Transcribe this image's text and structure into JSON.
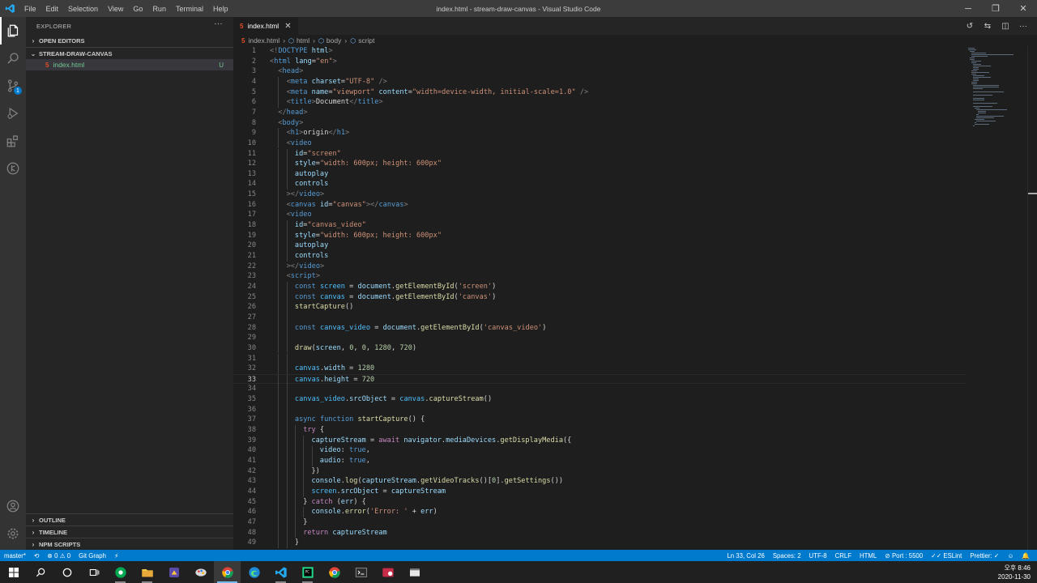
{
  "titlebar": {
    "title": "index.html - stream-draw-canvas - Visual Studio Code",
    "menu": [
      "File",
      "Edit",
      "Selection",
      "View",
      "Go",
      "Run",
      "Terminal",
      "Help"
    ],
    "controls": [
      "─",
      "❐",
      "✕"
    ]
  },
  "activitybar": {
    "items": [
      "explorer-icon",
      "search-icon",
      "source-control-icon",
      "run-debug-icon",
      "extensions-icon",
      "git-graph-icon"
    ],
    "scm_badge": "1",
    "bottom": [
      "account-icon",
      "settings-gear-icon"
    ]
  },
  "sidebar": {
    "title": "EXPLORER",
    "more": "···",
    "open_editors": "OPEN EDITORS",
    "folder": "STREAM-DRAW-CANVAS",
    "file": {
      "name": "index.html",
      "status": "U"
    },
    "outline": "OUTLINE",
    "timeline": "TIMELINE",
    "npm_scripts": "NPM SCRIPTS"
  },
  "tab": {
    "label": "index.html",
    "close": "✕"
  },
  "tab_actions": [
    "↺",
    "⇆",
    "◫",
    "···"
  ],
  "breadcrumb": [
    "index.html",
    "html",
    "body",
    "script"
  ],
  "code_lines": [
    {
      "n": "1",
      "indent": 0,
      "t": [
        [
          "br",
          "<!"
        ],
        [
          "tag",
          "DOCTYPE "
        ],
        [
          "attr",
          "html"
        ],
        [
          "br",
          ">"
        ]
      ]
    },
    {
      "n": "2",
      "indent": 0,
      "t": [
        [
          "br",
          "<"
        ],
        [
          "tag",
          "html "
        ],
        [
          "attr",
          "lang"
        ],
        [
          "txt",
          "="
        ],
        [
          "str",
          "\"en\""
        ],
        [
          "br",
          ">"
        ]
      ]
    },
    {
      "n": "3",
      "indent": 1,
      "t": [
        [
          "br",
          "<"
        ],
        [
          "tag",
          "head"
        ],
        [
          "br",
          ">"
        ]
      ]
    },
    {
      "n": "4",
      "indent": 2,
      "t": [
        [
          "br",
          "<"
        ],
        [
          "tag",
          "meta "
        ],
        [
          "attr",
          "charset"
        ],
        [
          "txt",
          "="
        ],
        [
          "str",
          "\"UTF-8\""
        ],
        [
          "br",
          " />"
        ]
      ]
    },
    {
      "n": "5",
      "indent": 2,
      "t": [
        [
          "br",
          "<"
        ],
        [
          "tag",
          "meta "
        ],
        [
          "attr",
          "name"
        ],
        [
          "txt",
          "="
        ],
        [
          "str",
          "\"viewport\" "
        ],
        [
          "attr",
          "content"
        ],
        [
          "txt",
          "="
        ],
        [
          "str",
          "\"width=device-width, initial-scale=1.0\""
        ],
        [
          "br",
          " />"
        ]
      ]
    },
    {
      "n": "6",
      "indent": 2,
      "t": [
        [
          "br",
          "<"
        ],
        [
          "tag",
          "title"
        ],
        [
          "br",
          ">"
        ],
        [
          "txt",
          "Document"
        ],
        [
          "br",
          "</"
        ],
        [
          "tag",
          "title"
        ],
        [
          "br",
          ">"
        ]
      ]
    },
    {
      "n": "7",
      "indent": 1,
      "t": [
        [
          "br",
          "</"
        ],
        [
          "tag",
          "head"
        ],
        [
          "br",
          ">"
        ]
      ]
    },
    {
      "n": "8",
      "indent": 1,
      "t": [
        [
          "br",
          "<"
        ],
        [
          "tag",
          "body"
        ],
        [
          "br",
          ">"
        ]
      ]
    },
    {
      "n": "9",
      "indent": 2,
      "t": [
        [
          "br",
          "<"
        ],
        [
          "tag",
          "h1"
        ],
        [
          "br",
          ">"
        ],
        [
          "txt",
          "origin"
        ],
        [
          "br",
          "</"
        ],
        [
          "tag",
          "h1"
        ],
        [
          "br",
          ">"
        ]
      ]
    },
    {
      "n": "10",
      "indent": 2,
      "t": [
        [
          "br",
          "<"
        ],
        [
          "tag",
          "video"
        ]
      ]
    },
    {
      "n": "11",
      "indent": 3,
      "t": [
        [
          "attr",
          "id"
        ],
        [
          "txt",
          "="
        ],
        [
          "str",
          "\"screen\""
        ]
      ]
    },
    {
      "n": "12",
      "indent": 3,
      "t": [
        [
          "attr",
          "style"
        ],
        [
          "txt",
          "="
        ],
        [
          "str",
          "\"width: 600px; height: 600px\""
        ]
      ]
    },
    {
      "n": "13",
      "indent": 3,
      "t": [
        [
          "attr",
          "autoplay"
        ]
      ]
    },
    {
      "n": "14",
      "indent": 3,
      "t": [
        [
          "attr",
          "controls"
        ]
      ]
    },
    {
      "n": "15",
      "indent": 2,
      "t": [
        [
          "br",
          "></"
        ],
        [
          "tag",
          "video"
        ],
        [
          "br",
          ">"
        ]
      ]
    },
    {
      "n": "16",
      "indent": 2,
      "t": [
        [
          "br",
          "<"
        ],
        [
          "tag",
          "canvas "
        ],
        [
          "attr",
          "id"
        ],
        [
          "txt",
          "="
        ],
        [
          "str",
          "\"canvas\""
        ],
        [
          "br",
          "></"
        ],
        [
          "tag",
          "canvas"
        ],
        [
          "br",
          ">"
        ]
      ]
    },
    {
      "n": "17",
      "indent": 2,
      "t": [
        [
          "br",
          "<"
        ],
        [
          "tag",
          "video"
        ]
      ]
    },
    {
      "n": "18",
      "indent": 3,
      "t": [
        [
          "attr",
          "id"
        ],
        [
          "txt",
          "="
        ],
        [
          "str",
          "\"canvas_video\""
        ]
      ]
    },
    {
      "n": "19",
      "indent": 3,
      "t": [
        [
          "attr",
          "style"
        ],
        [
          "txt",
          "="
        ],
        [
          "str",
          "\"width: 600px; height: 600px\""
        ]
      ]
    },
    {
      "n": "20",
      "indent": 3,
      "t": [
        [
          "attr",
          "autoplay"
        ]
      ]
    },
    {
      "n": "21",
      "indent": 3,
      "t": [
        [
          "attr",
          "controls"
        ]
      ]
    },
    {
      "n": "22",
      "indent": 2,
      "t": [
        [
          "br",
          "></"
        ],
        [
          "tag",
          "video"
        ],
        [
          "br",
          ">"
        ]
      ]
    },
    {
      "n": "23",
      "indent": 2,
      "t": [
        [
          "br",
          "<"
        ],
        [
          "tag",
          "script"
        ],
        [
          "br",
          ">"
        ]
      ]
    },
    {
      "n": "24",
      "indent": 3,
      "t": [
        [
          "kw",
          "const "
        ],
        [
          "const",
          "screen"
        ],
        [
          "txt",
          " = "
        ],
        [
          "var",
          "document"
        ],
        [
          "txt",
          "."
        ],
        [
          "fn",
          "getElementById"
        ],
        [
          "txt",
          "("
        ],
        [
          "str",
          "'screen'"
        ],
        [
          "txt",
          ")"
        ]
      ]
    },
    {
      "n": "25",
      "indent": 3,
      "t": [
        [
          "kw",
          "const "
        ],
        [
          "const",
          "canvas"
        ],
        [
          "txt",
          " = "
        ],
        [
          "var",
          "document"
        ],
        [
          "txt",
          "."
        ],
        [
          "fn",
          "getElementById"
        ],
        [
          "txt",
          "("
        ],
        [
          "str",
          "'canvas'"
        ],
        [
          "txt",
          ")"
        ]
      ]
    },
    {
      "n": "26",
      "indent": 3,
      "t": [
        [
          "fn",
          "startCapture"
        ],
        [
          "txt",
          "()"
        ]
      ]
    },
    {
      "n": "27",
      "indent": 3,
      "t": []
    },
    {
      "n": "28",
      "indent": 3,
      "t": [
        [
          "kw",
          "const "
        ],
        [
          "const",
          "canvas_video"
        ],
        [
          "txt",
          " = "
        ],
        [
          "var",
          "document"
        ],
        [
          "txt",
          "."
        ],
        [
          "fn",
          "getElementById"
        ],
        [
          "txt",
          "("
        ],
        [
          "str",
          "'canvas_video'"
        ],
        [
          "txt",
          ")"
        ]
      ]
    },
    {
      "n": "29",
      "indent": 3,
      "t": []
    },
    {
      "n": "30",
      "indent": 3,
      "t": [
        [
          "fn",
          "draw"
        ],
        [
          "txt",
          "("
        ],
        [
          "var",
          "screen"
        ],
        [
          "txt",
          ", "
        ],
        [
          "num",
          "0"
        ],
        [
          "txt",
          ", "
        ],
        [
          "num",
          "0"
        ],
        [
          "txt",
          ", "
        ],
        [
          "num",
          "1280"
        ],
        [
          "txt",
          ", "
        ],
        [
          "num",
          "720"
        ],
        [
          "txt",
          ")"
        ]
      ]
    },
    {
      "n": "31",
      "indent": 3,
      "t": []
    },
    {
      "n": "32",
      "indent": 3,
      "t": [
        [
          "const",
          "canvas"
        ],
        [
          "txt",
          "."
        ],
        [
          "var",
          "width"
        ],
        [
          "txt",
          " = "
        ],
        [
          "num",
          "1280"
        ]
      ]
    },
    {
      "n": "33",
      "indent": 3,
      "cur": true,
      "t": [
        [
          "const",
          "canvas"
        ],
        [
          "txt",
          "."
        ],
        [
          "var",
          "height"
        ],
        [
          "txt",
          " = "
        ],
        [
          "num",
          "720"
        ]
      ]
    },
    {
      "n": "34",
      "indent": 3,
      "t": []
    },
    {
      "n": "35",
      "indent": 3,
      "t": [
        [
          "const",
          "canvas_video"
        ],
        [
          "txt",
          "."
        ],
        [
          "var",
          "srcObject"
        ],
        [
          "txt",
          " = "
        ],
        [
          "const",
          "canvas"
        ],
        [
          "txt",
          "."
        ],
        [
          "fn",
          "captureStream"
        ],
        [
          "txt",
          "()"
        ]
      ]
    },
    {
      "n": "36",
      "indent": 3,
      "t": []
    },
    {
      "n": "37",
      "indent": 3,
      "t": [
        [
          "kw",
          "async "
        ],
        [
          "kw",
          "function "
        ],
        [
          "fn",
          "startCapture"
        ],
        [
          "txt",
          "() {"
        ]
      ]
    },
    {
      "n": "38",
      "indent": 4,
      "t": [
        [
          "ctl",
          "try "
        ],
        [
          "txt",
          "{"
        ]
      ]
    },
    {
      "n": "39",
      "indent": 5,
      "t": [
        [
          "var",
          "captureStream"
        ],
        [
          "txt",
          " = "
        ],
        [
          "ctl",
          "await "
        ],
        [
          "var",
          "navigator"
        ],
        [
          "txt",
          "."
        ],
        [
          "var",
          "mediaDevices"
        ],
        [
          "txt",
          "."
        ],
        [
          "fn",
          "getDisplayMedia"
        ],
        [
          "txt",
          "({"
        ]
      ]
    },
    {
      "n": "40",
      "indent": 6,
      "t": [
        [
          "var",
          "video"
        ],
        [
          "txt",
          ": "
        ],
        [
          "kw",
          "true"
        ],
        [
          "txt",
          ","
        ]
      ]
    },
    {
      "n": "41",
      "indent": 6,
      "t": [
        [
          "var",
          "audio"
        ],
        [
          "txt",
          ": "
        ],
        [
          "kw",
          "true"
        ],
        [
          "txt",
          ","
        ]
      ]
    },
    {
      "n": "42",
      "indent": 5,
      "t": [
        [
          "txt",
          "})"
        ]
      ]
    },
    {
      "n": "43",
      "indent": 5,
      "t": [
        [
          "var",
          "console"
        ],
        [
          "txt",
          "."
        ],
        [
          "fn",
          "log"
        ],
        [
          "txt",
          "("
        ],
        [
          "var",
          "captureStream"
        ],
        [
          "txt",
          "."
        ],
        [
          "fn",
          "getVideoTracks"
        ],
        [
          "txt",
          "()["
        ],
        [
          "num",
          "0"
        ],
        [
          "txt",
          "]."
        ],
        [
          "fn",
          "getSettings"
        ],
        [
          "txt",
          "())"
        ]
      ]
    },
    {
      "n": "44",
      "indent": 5,
      "t": [
        [
          "const",
          "screen"
        ],
        [
          "txt",
          "."
        ],
        [
          "var",
          "srcObject"
        ],
        [
          "txt",
          " = "
        ],
        [
          "var",
          "captureStream"
        ]
      ]
    },
    {
      "n": "45",
      "indent": 4,
      "t": [
        [
          "txt",
          "} "
        ],
        [
          "ctl",
          "catch "
        ],
        [
          "txt",
          "("
        ],
        [
          "var",
          "err"
        ],
        [
          "txt",
          ") {"
        ]
      ]
    },
    {
      "n": "46",
      "indent": 5,
      "t": [
        [
          "var",
          "console"
        ],
        [
          "txt",
          "."
        ],
        [
          "fn",
          "error"
        ],
        [
          "txt",
          "("
        ],
        [
          "str",
          "'Error: '"
        ],
        [
          "txt",
          " + "
        ],
        [
          "var",
          "err"
        ],
        [
          "txt",
          ")"
        ]
      ]
    },
    {
      "n": "47",
      "indent": 4,
      "t": [
        [
          "txt",
          "}"
        ]
      ]
    },
    {
      "n": "48",
      "indent": 4,
      "t": [
        [
          "ctl",
          "return "
        ],
        [
          "var",
          "captureStream"
        ]
      ]
    },
    {
      "n": "49",
      "indent": 3,
      "t": [
        [
          "txt",
          "}"
        ]
      ]
    }
  ],
  "statusbar": {
    "branch": "master*",
    "sync": "⟲",
    "problems": "⊗ 0 ⚠ 0",
    "git_graph": "Git Graph",
    "live": "⚡",
    "position": "Ln 33, Col 26",
    "spaces": "Spaces: 2",
    "encoding": "UTF-8",
    "eol": "CRLF",
    "language": "HTML",
    "port": "⊘ Port : 5500",
    "eslint": "✓✓ ESLint",
    "prettier": "Prettier: ✓",
    "feedback": "☺",
    "bell": "🔔"
  },
  "taskbar": {
    "apps": [
      "start-icon",
      "search-icon",
      "cortana-icon",
      "task-view-icon",
      "app-green-icon",
      "file-explorer-icon",
      "app-purple-icon",
      "app-paint-icon",
      "chrome-icon",
      "edge-icon",
      "vscode-icon",
      "pycharm-icon",
      "chrome-alt-icon",
      "terminal-icon",
      "app-red-icon",
      "app-window-icon"
    ],
    "time": "오후 8:46",
    "date": "2020-11-30"
  },
  "colors": {
    "accent": "#007acc",
    "titlebar": "#3c3c3c",
    "sidebar": "#252526",
    "editor": "#1e1e1e"
  }
}
